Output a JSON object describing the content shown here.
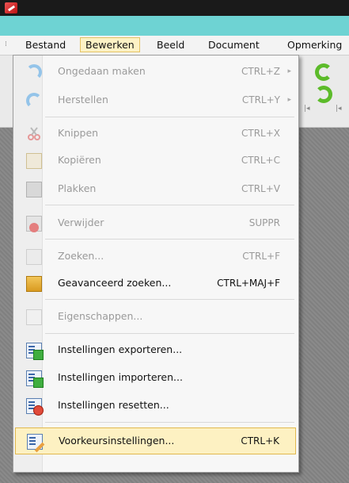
{
  "menubar": {
    "items": [
      {
        "label": "Bestand"
      },
      {
        "label": "Bewerken"
      },
      {
        "label": "Beeld"
      },
      {
        "label": "Document"
      },
      {
        "label": "Opmerking"
      }
    ]
  },
  "dropdown": {
    "items": [
      {
        "label": "Ongedaan maken",
        "shortcut": "CTRL+Z",
        "icon": "undo-icon",
        "enabled": false,
        "submenu": true
      },
      {
        "label": "Herstellen",
        "shortcut": "CTRL+Y",
        "icon": "redo-icon",
        "enabled": false,
        "submenu": true
      },
      {
        "label": "Knippen",
        "shortcut": "CTRL+X",
        "icon": "scissors-icon",
        "enabled": false
      },
      {
        "label": "Kopiëren",
        "shortcut": "CTRL+C",
        "icon": "copy-icon",
        "enabled": false
      },
      {
        "label": "Plakken",
        "shortcut": "CTRL+V",
        "icon": "paste-icon",
        "enabled": false
      },
      {
        "label": "Verwijder",
        "shortcut": "SUPPR",
        "icon": "delete-icon",
        "enabled": false
      },
      {
        "label": "Zoeken...",
        "shortcut": "CTRL+F",
        "icon": "search-icon",
        "enabled": false
      },
      {
        "label": "Geavanceerd zoeken...",
        "shortcut": "CTRL+MAJ+F",
        "icon": "advanced-search-icon",
        "enabled": true
      },
      {
        "label": "Eigenschappen...",
        "shortcut": "",
        "icon": "properties-icon",
        "enabled": false
      },
      {
        "label": "Instellingen exporteren...",
        "shortcut": "",
        "icon": "export-settings-icon",
        "enabled": true
      },
      {
        "label": "Instellingen importeren...",
        "shortcut": "",
        "icon": "import-settings-icon",
        "enabled": true
      },
      {
        "label": "Instellingen resetten...",
        "shortcut": "",
        "icon": "reset-settings-icon",
        "enabled": true
      },
      {
        "label": "Voorkeursinstellingen...",
        "shortcut": "CTRL+K",
        "icon": "preferences-icon",
        "enabled": true,
        "highlighted": true
      }
    ],
    "submenu_glyph": "▸"
  },
  "colors": {
    "titlebar": "#1a1a1a",
    "accent_bar": "#6ed3d3",
    "highlight_bg": "#fdf1c2",
    "highlight_border": "#e2b94e",
    "disabled_text": "#9a9a9a"
  }
}
